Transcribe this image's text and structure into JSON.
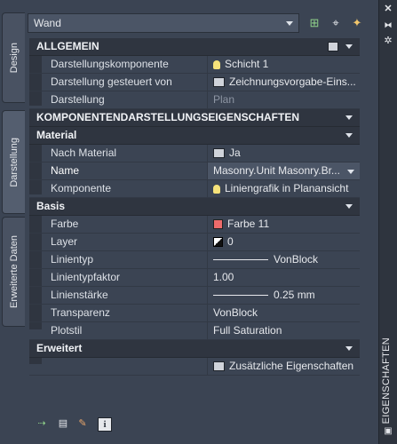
{
  "window": {
    "title": "EIGENSCHAFTEN"
  },
  "left_tabs": [
    {
      "label": "Design"
    },
    {
      "label": "Darstellung"
    },
    {
      "label": "Erweiterte Daten"
    }
  ],
  "toolbar": {
    "combo_value": "Wand"
  },
  "sections": {
    "allgemein": "ALLGEMEIN",
    "komponenten": "KOMPONENTENDARSTELLUNGSEIGENSCHAFTEN",
    "material": "Material",
    "basis": "Basis",
    "erweitert": "Erweitert"
  },
  "allgemein_rows": [
    {
      "key": "Darstellungskomponente",
      "value": "Schicht 1"
    },
    {
      "key": "Darstellung gesteuert von",
      "value": "Zeichnungsvorgabe-Eins..."
    },
    {
      "key": "Darstellung",
      "value": "Plan"
    }
  ],
  "material_rows": [
    {
      "key": "Nach Material",
      "value": "Ja"
    },
    {
      "key": "Name",
      "value": "Masonry.Unit  Masonry.Br..."
    },
    {
      "key": "Komponente",
      "value": "Liniengrafik in Planansicht"
    }
  ],
  "basis_rows": [
    {
      "key": "Farbe",
      "value": "Farbe 11"
    },
    {
      "key": "Layer",
      "value": "0"
    },
    {
      "key": "Linientyp",
      "value": "VonBlock"
    },
    {
      "key": "Linientypfaktor",
      "value": "1.00"
    },
    {
      "key": "Linienstärke",
      "value": "0.25 mm"
    },
    {
      "key": "Transparenz",
      "value": "VonBlock"
    },
    {
      "key": "Plotstil",
      "value": "Full Saturation"
    }
  ],
  "erweitert_row": {
    "value": "Zusätzliche Eigenschaften"
  },
  "colors": {
    "panel": "#3b4453",
    "section": "#2f3540",
    "accent_red": "#ee6b6b"
  }
}
